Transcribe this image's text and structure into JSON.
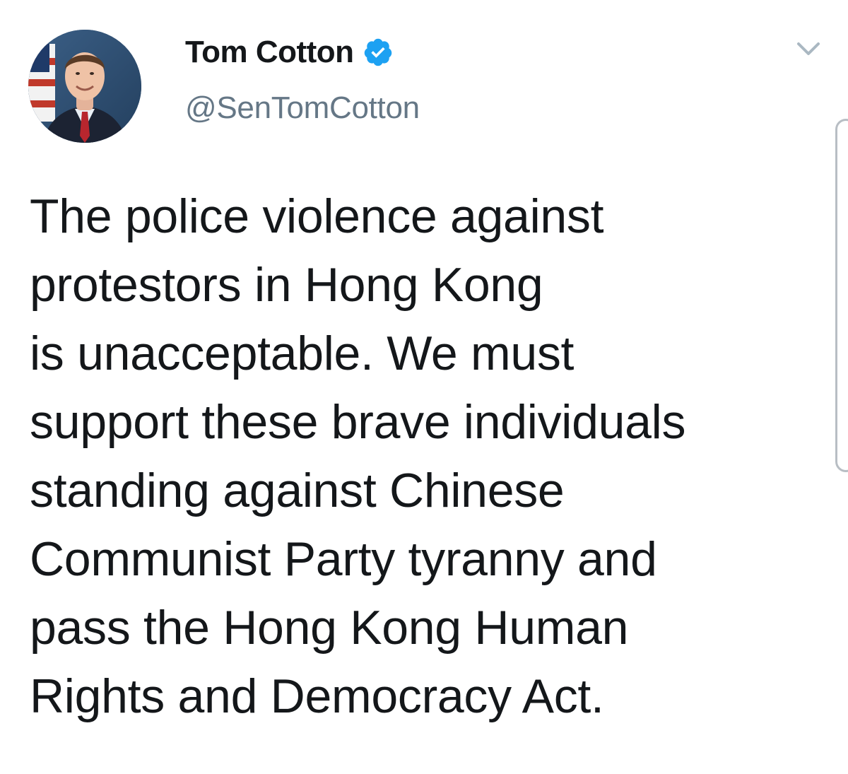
{
  "tweet": {
    "author": {
      "display_name": "Tom Cotton",
      "handle": "@SenTomCotton",
      "verified_icon": "verified-badge-icon",
      "avatar_icon": "profile-photo"
    },
    "menu_icon": "chevron-down-icon",
    "text_lines": [
      "The police violence against",
      "protestors in Hong Kong",
      "is unacceptable. We must",
      "support these brave individuals",
      "standing against Chinese",
      "Communist Party tyranny and",
      "pass the Hong Kong Human",
      "Rights and Democracy Act."
    ]
  },
  "colors": {
    "text_primary": "#14171a",
    "text_secondary": "#657786",
    "verified_blue": "#1da1f2",
    "chevron": "#aab8c2"
  }
}
